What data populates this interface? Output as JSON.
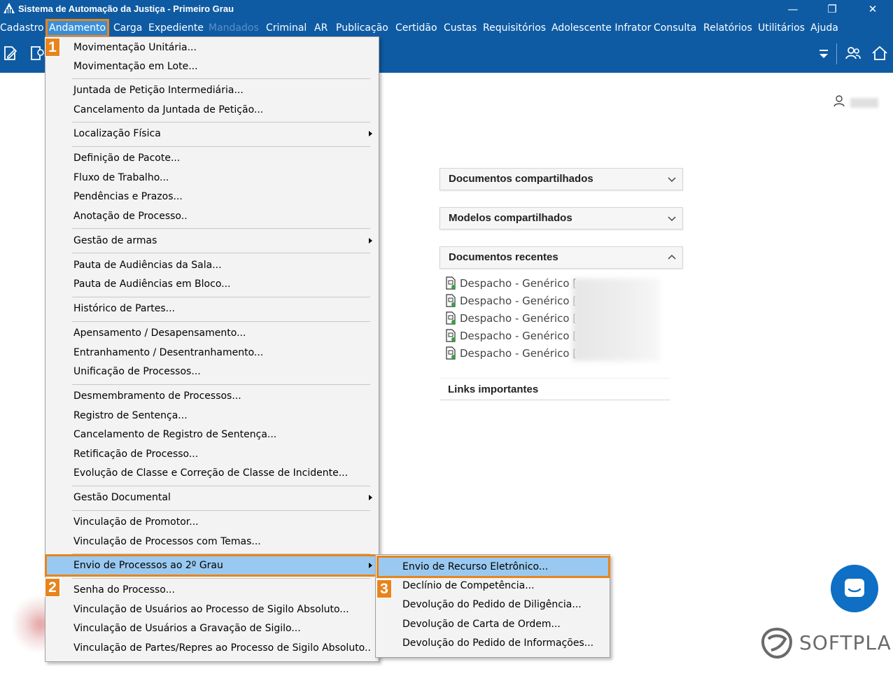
{
  "window": {
    "title": "Sistema de Automação da Justiça - Primeiro Grau",
    "minimize": "—",
    "restore": "❐",
    "close": "✕"
  },
  "menubar": [
    {
      "label": "Cadastro"
    },
    {
      "label": "Andamento",
      "active": true
    },
    {
      "label": "Carga"
    },
    {
      "label": "Expediente"
    },
    {
      "label": "Mandados",
      "disabled": true
    },
    {
      "label": "Criminal"
    },
    {
      "label": "AR"
    },
    {
      "label": "Publicação"
    },
    {
      "label": "Certidão"
    },
    {
      "label": "Custas"
    },
    {
      "label": "Requisitórios"
    },
    {
      "label": "Adolescente Infrator"
    },
    {
      "label": "Consulta"
    },
    {
      "label": "Relatórios"
    },
    {
      "label": "Utilitários"
    },
    {
      "label": "Ajuda"
    }
  ],
  "badges": [
    "1",
    "2",
    "3"
  ],
  "andamento_menu": [
    {
      "label": "Movimentação Unitária..."
    },
    {
      "label": "Movimentação em Lote..."
    },
    {
      "label": "Juntada de Petição Intermediária..."
    },
    {
      "label": "Cancelamento da Juntada de Petição..."
    },
    {
      "label": "Localização Física",
      "submenu": true
    },
    {
      "label": "Definição de Pacote..."
    },
    {
      "label": "Fluxo de Trabalho..."
    },
    {
      "label": "Pendências e Prazos..."
    },
    {
      "label": "Anotação de Processo.."
    },
    {
      "label": "Gestão de armas",
      "submenu": true
    },
    {
      "label": "Pauta de Audiências da Sala..."
    },
    {
      "label": "Pauta de Audiências em Bloco..."
    },
    {
      "label": "Histórico de Partes..."
    },
    {
      "label": "Apensamento / Desapensamento..."
    },
    {
      "label": "Entranhamento / Desentranhamento..."
    },
    {
      "label": "Unificação de Processos..."
    },
    {
      "label": "Desmembramento de Processos..."
    },
    {
      "label": "Registro de Sentença..."
    },
    {
      "label": "Cancelamento de Registro de Sentença..."
    },
    {
      "label": "Retificação de Processo..."
    },
    {
      "label": "Evolução de Classe e Correção de Classe de Incidente..."
    },
    {
      "label": "Gestão Documental",
      "submenu": true
    },
    {
      "label": "Vinculação de Promotor..."
    },
    {
      "label": "Vinculação de Processos com Temas..."
    },
    {
      "label": "Envio de Processos ao 2º Grau",
      "submenu": true,
      "highlighted": true
    },
    {
      "label": "Senha do Processo..."
    },
    {
      "label": "Vinculação de Usuários ao Processo de Sigilo Absoluto..."
    },
    {
      "label": "Vinculação de Usuários a Gravação de Sigilo..."
    },
    {
      "label": "Vinculação de Partes/Repres ao Processo de Sigilo Absoluto.."
    }
  ],
  "envio_submenu": [
    {
      "label": "Envio de Recurso Eletrônico...",
      "highlighted": true
    },
    {
      "label": "Declínio de Competência..."
    },
    {
      "label": "Devolução do Pedido de Diligência..."
    },
    {
      "label": "Devolução de Carta de Ordem..."
    },
    {
      "label": "Devolução do Pedido de Informações..."
    }
  ],
  "panels": {
    "documentos_compartilhados": "Documentos compartilhados",
    "modelos_compartilhados": "Modelos compartilhados",
    "documentos_recentes": "Documentos recentes",
    "links_importantes": "Links importantes"
  },
  "recent_docs": [
    {
      "label": "Despacho - Genérico ["
    },
    {
      "label": "Despacho - Genérico ["
    },
    {
      "label": "Despacho - Genérico ["
    },
    {
      "label": "Despacho - Genérico ["
    },
    {
      "label": "Despacho - Genérico ["
    }
  ],
  "brand": {
    "logo_text": "SOFTPLAN"
  },
  "colors": {
    "header_blue": "#0e5ba3",
    "highlight_orange": "#e8841c",
    "menu_highlight": "#99c9f0",
    "chat_blue": "#0e6fc4"
  }
}
